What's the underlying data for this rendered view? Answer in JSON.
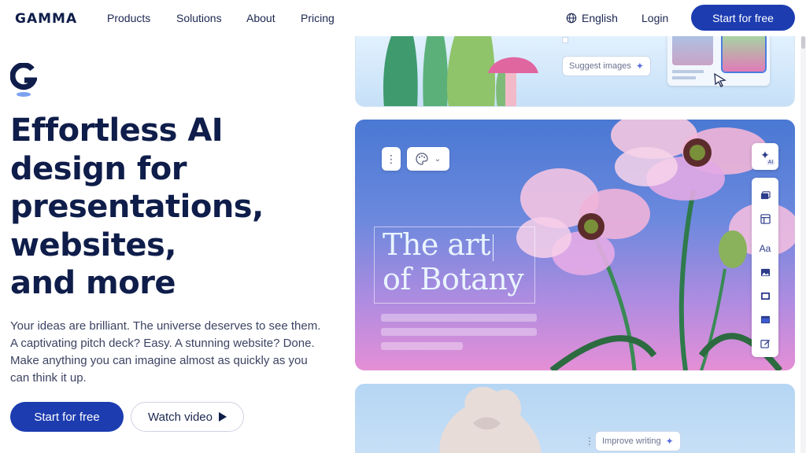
{
  "nav": {
    "logo": "GAMMA",
    "links": [
      "Products",
      "Solutions",
      "About",
      "Pricing"
    ],
    "language": "English",
    "login": "Login",
    "cta": "Start for free"
  },
  "hero": {
    "headline": [
      "Effortless AI",
      "design for",
      "presentations,",
      "websites,",
      "and more"
    ],
    "subtitle": [
      "Your ideas are brilliant. The universe deserves to see them.",
      "A captivating pitch deck? Easy. A stunning website? Done.",
      "Make anything you can imagine almost as quickly as you",
      "can think it up."
    ],
    "primary_button": "Start for free",
    "secondary_button": "Watch video"
  },
  "showcase": {
    "suggest_images": "Suggest images",
    "title_lines": [
      "The art",
      "of Botany"
    ],
    "ai_badge": "AI",
    "font_tool": "Aa",
    "improve_writing": "Improve writing"
  },
  "colors": {
    "brand": "#1c3cb0",
    "text": "#0f1d4a"
  },
  "icons": [
    "globe-icon",
    "play-icon",
    "sparkle-icon",
    "palette-icon",
    "chevron-down-icon",
    "more-vertical-icon",
    "cursor-icon"
  ]
}
